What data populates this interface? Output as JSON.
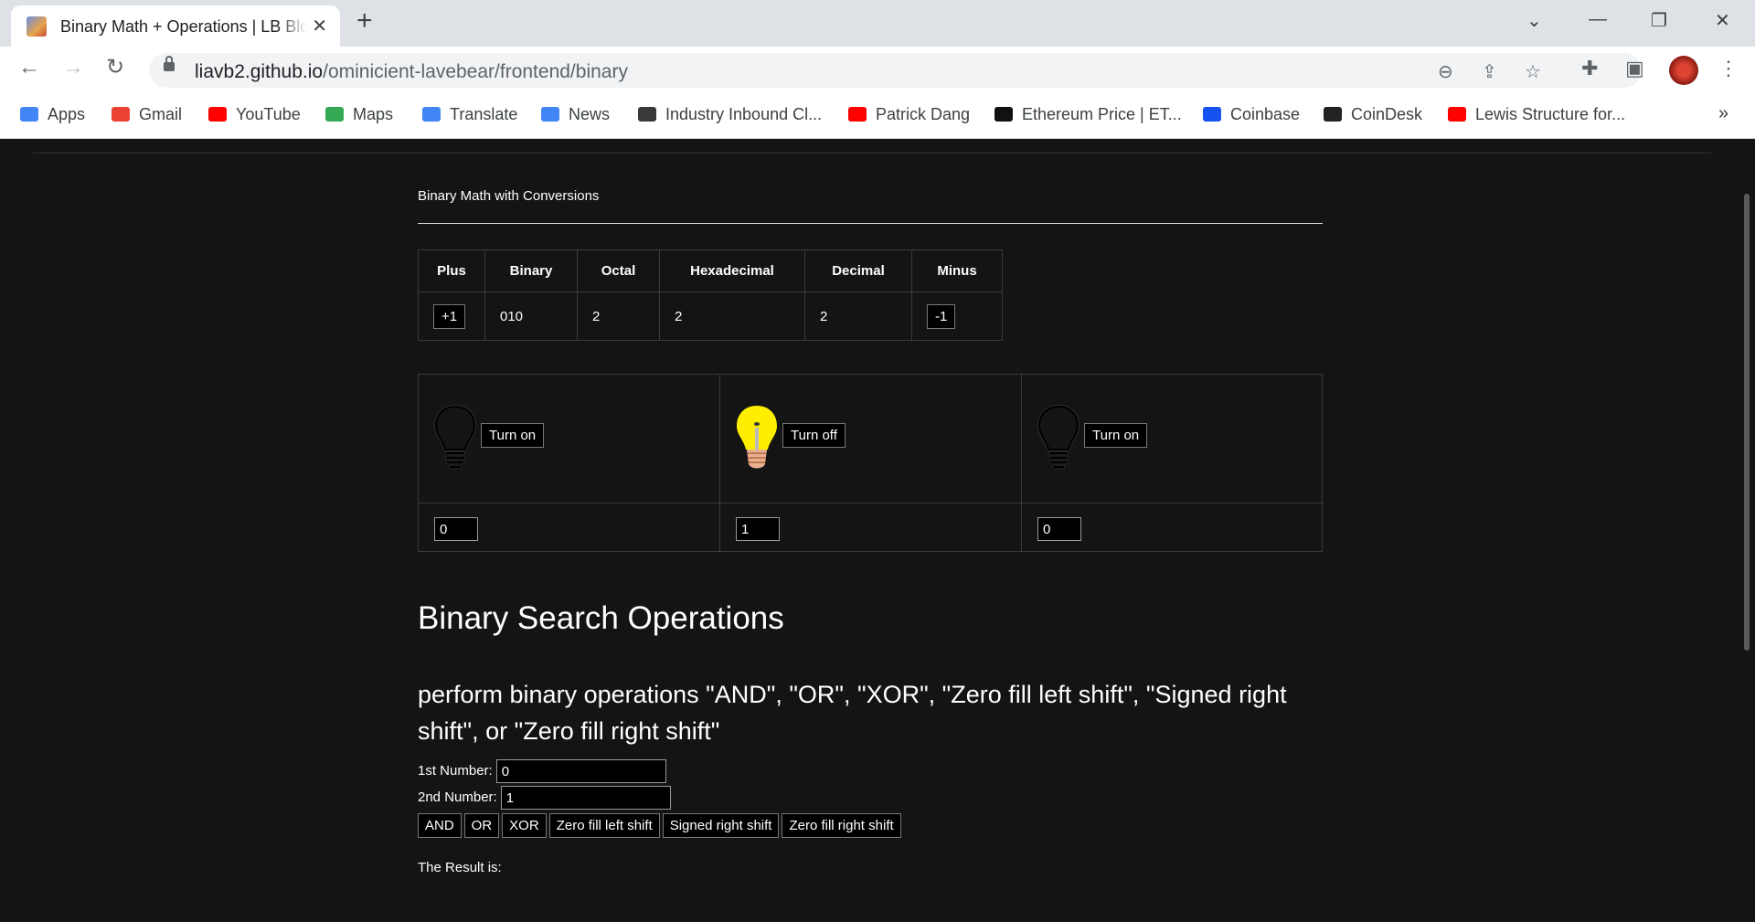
{
  "browser": {
    "tab_title": "Binary Math + Operations | LB Blog",
    "url_host": "liavb2.github.io",
    "url_path": "/ominicient-lavebear/frontend/binary",
    "bookmarks": [
      {
        "label": "Apps",
        "color": "#4285f4"
      },
      {
        "label": "Gmail",
        "color": "#ea4335"
      },
      {
        "label": "YouTube",
        "color": "#ff0000"
      },
      {
        "label": "Maps",
        "color": "#34a853"
      },
      {
        "label": "Translate",
        "color": "#4285f4"
      },
      {
        "label": "News",
        "color": "#4285f4"
      },
      {
        "label": "Industry Inbound Cl...",
        "color": "#3a3a3a"
      },
      {
        "label": "Patrick Dang",
        "color": "#ff0000"
      },
      {
        "label": "Ethereum Price | ET...",
        "color": "#111111"
      },
      {
        "label": "Coinbase",
        "color": "#1652f0"
      },
      {
        "label": "CoinDesk",
        "color": "#222222"
      },
      {
        "label": "Lewis Structure for...",
        "color": "#ff0000"
      }
    ]
  },
  "page": {
    "subtitle": "Binary Math with Conversions",
    "table": {
      "headers": [
        "Plus",
        "Binary",
        "Octal",
        "Hexadecimal",
        "Decimal",
        "Minus"
      ],
      "plus_label": "+1",
      "binary": "010",
      "octal": "2",
      "hexadecimal": "2",
      "decimal": "2",
      "minus_label": "-1"
    },
    "bits": [
      {
        "button": "Turn on",
        "value": "0",
        "lit": false
      },
      {
        "button": "Turn off",
        "value": "1",
        "lit": true
      },
      {
        "button": "Turn on",
        "value": "0",
        "lit": false
      }
    ],
    "ops_title": "Binary Search Operations",
    "ops_desc": "perform binary operations \"AND\", \"OR\", \"XOR\", \"Zero fill left shift\", \"Signed right shift\", or \"Zero fill right shift\"",
    "first_label": "1st Number:",
    "first_value": "0",
    "second_label": "2nd Number:",
    "second_value": "1",
    "op_buttons": [
      "AND",
      "OR",
      "XOR",
      "Zero fill left shift",
      "Signed right shift",
      "Zero fill right shift"
    ],
    "result_label": "The Result is:"
  },
  "colors": {
    "bulb_on": "#ffee00",
    "page_bg": "#141414"
  }
}
